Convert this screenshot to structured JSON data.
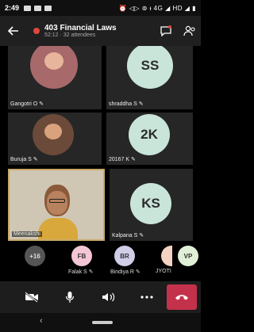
{
  "status_bar": {
    "time": "2:49",
    "right_text": "⏰ ◁▷ ⊚ ᵻ 4G ◢ HD ◢ ▮"
  },
  "header": {
    "meeting_title": "403 Financial Laws",
    "meeting_subtitle": "52:12 · 32 attendees"
  },
  "tiles": [
    {
      "name": "Gangotri O ✎",
      "type": "photo",
      "color": "#a8696b"
    },
    {
      "name": "shraddha S ✎",
      "type": "initials",
      "initials": "SS"
    },
    {
      "name": "Buruja S ✎",
      "type": "photo",
      "color": "#6b4a3a"
    },
    {
      "name": "20167 K ✎",
      "type": "initials",
      "initials": "2K"
    },
    {
      "name": "Meenakshi",
      "type": "video"
    },
    {
      "name": "Kalpana S ✎",
      "type": "initials",
      "initials": "KS"
    }
  ],
  "roster": [
    {
      "initials": "+16",
      "name": "",
      "color": "#555555"
    },
    {
      "initials": "FB",
      "name": "Falak S ✎",
      "color": "#f3c6d6"
    },
    {
      "initials": "BR",
      "name": "Bindiya R ✎",
      "color": "#cfcde8"
    },
    {
      "initials": "",
      "name": "JYOTI",
      "color": "#f4d3c4"
    },
    {
      "initials": "VP",
      "name": "",
      "color": "#dff0d6"
    }
  ],
  "controls": {
    "camera": "camera-off",
    "mic": "microphone",
    "speaker": "speaker",
    "more": "more",
    "hangup": "hang-up"
  },
  "colors": {
    "avatar_bg": "#c9e4d9",
    "hangup": "#c4314b",
    "active_speaker_border": "#c8a96a"
  }
}
